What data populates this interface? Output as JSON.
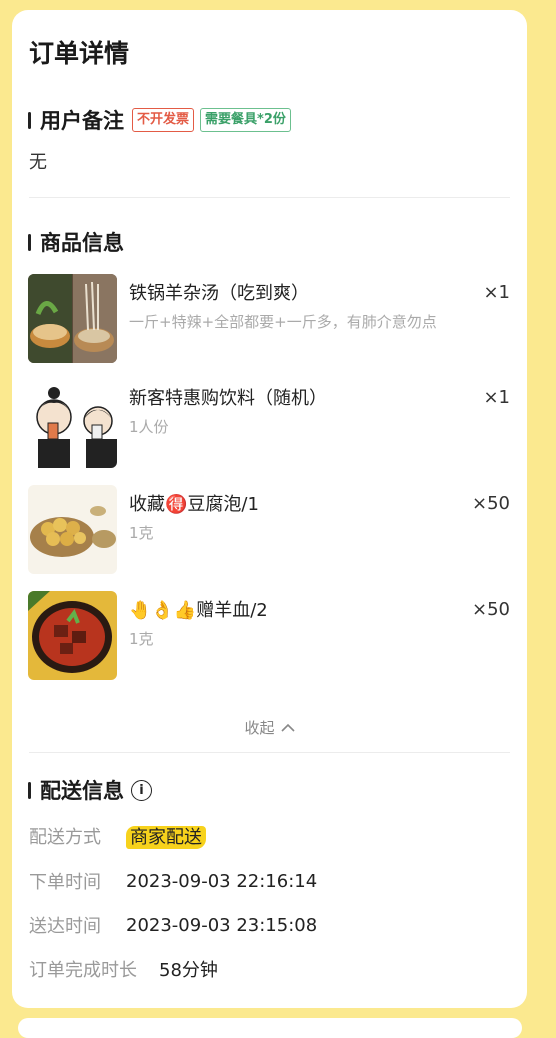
{
  "header": {
    "title": "订单详情"
  },
  "remark": {
    "title": "用户备注",
    "tags": [
      "不开发票",
      "需要餐具*2份"
    ],
    "text": "无"
  },
  "products": {
    "title": "商品信息",
    "items": [
      {
        "name": "铁锅羊杂汤（吃到爽）",
        "sub": "一斤+特辣+全部都要+一斤多，有肺介意勿点",
        "qty": "×1",
        "image": "soup-photo"
      },
      {
        "name": "新客特惠购饮料（随机）",
        "sub": "1人份",
        "qty": "×1",
        "image": "cartoon-drink-photo"
      },
      {
        "name": "收藏🉐豆腐泡/1",
        "sub": "1克",
        "qty": "×50",
        "image": "tofu-puff-photo"
      },
      {
        "name": "🤚👌👍赠羊血/2",
        "sub": "1克",
        "qty": "×50",
        "image": "lamb-blood-photo"
      }
    ],
    "collapse_label": "收起"
  },
  "delivery": {
    "title": "配送信息",
    "rows": [
      {
        "label": "配送方式",
        "value": "商家配送"
      },
      {
        "label": "下单时间",
        "value": "2023-09-03 22:16:14"
      },
      {
        "label": "送达时间",
        "value": "2023-09-03 23:15:08"
      },
      {
        "label": "订单完成时长",
        "value": "58分钟"
      }
    ]
  },
  "colors": {
    "background": "#fbe98f",
    "tag_red": "#e35b45",
    "tag_green": "#3aa068",
    "highlight": "#f7d21c"
  }
}
